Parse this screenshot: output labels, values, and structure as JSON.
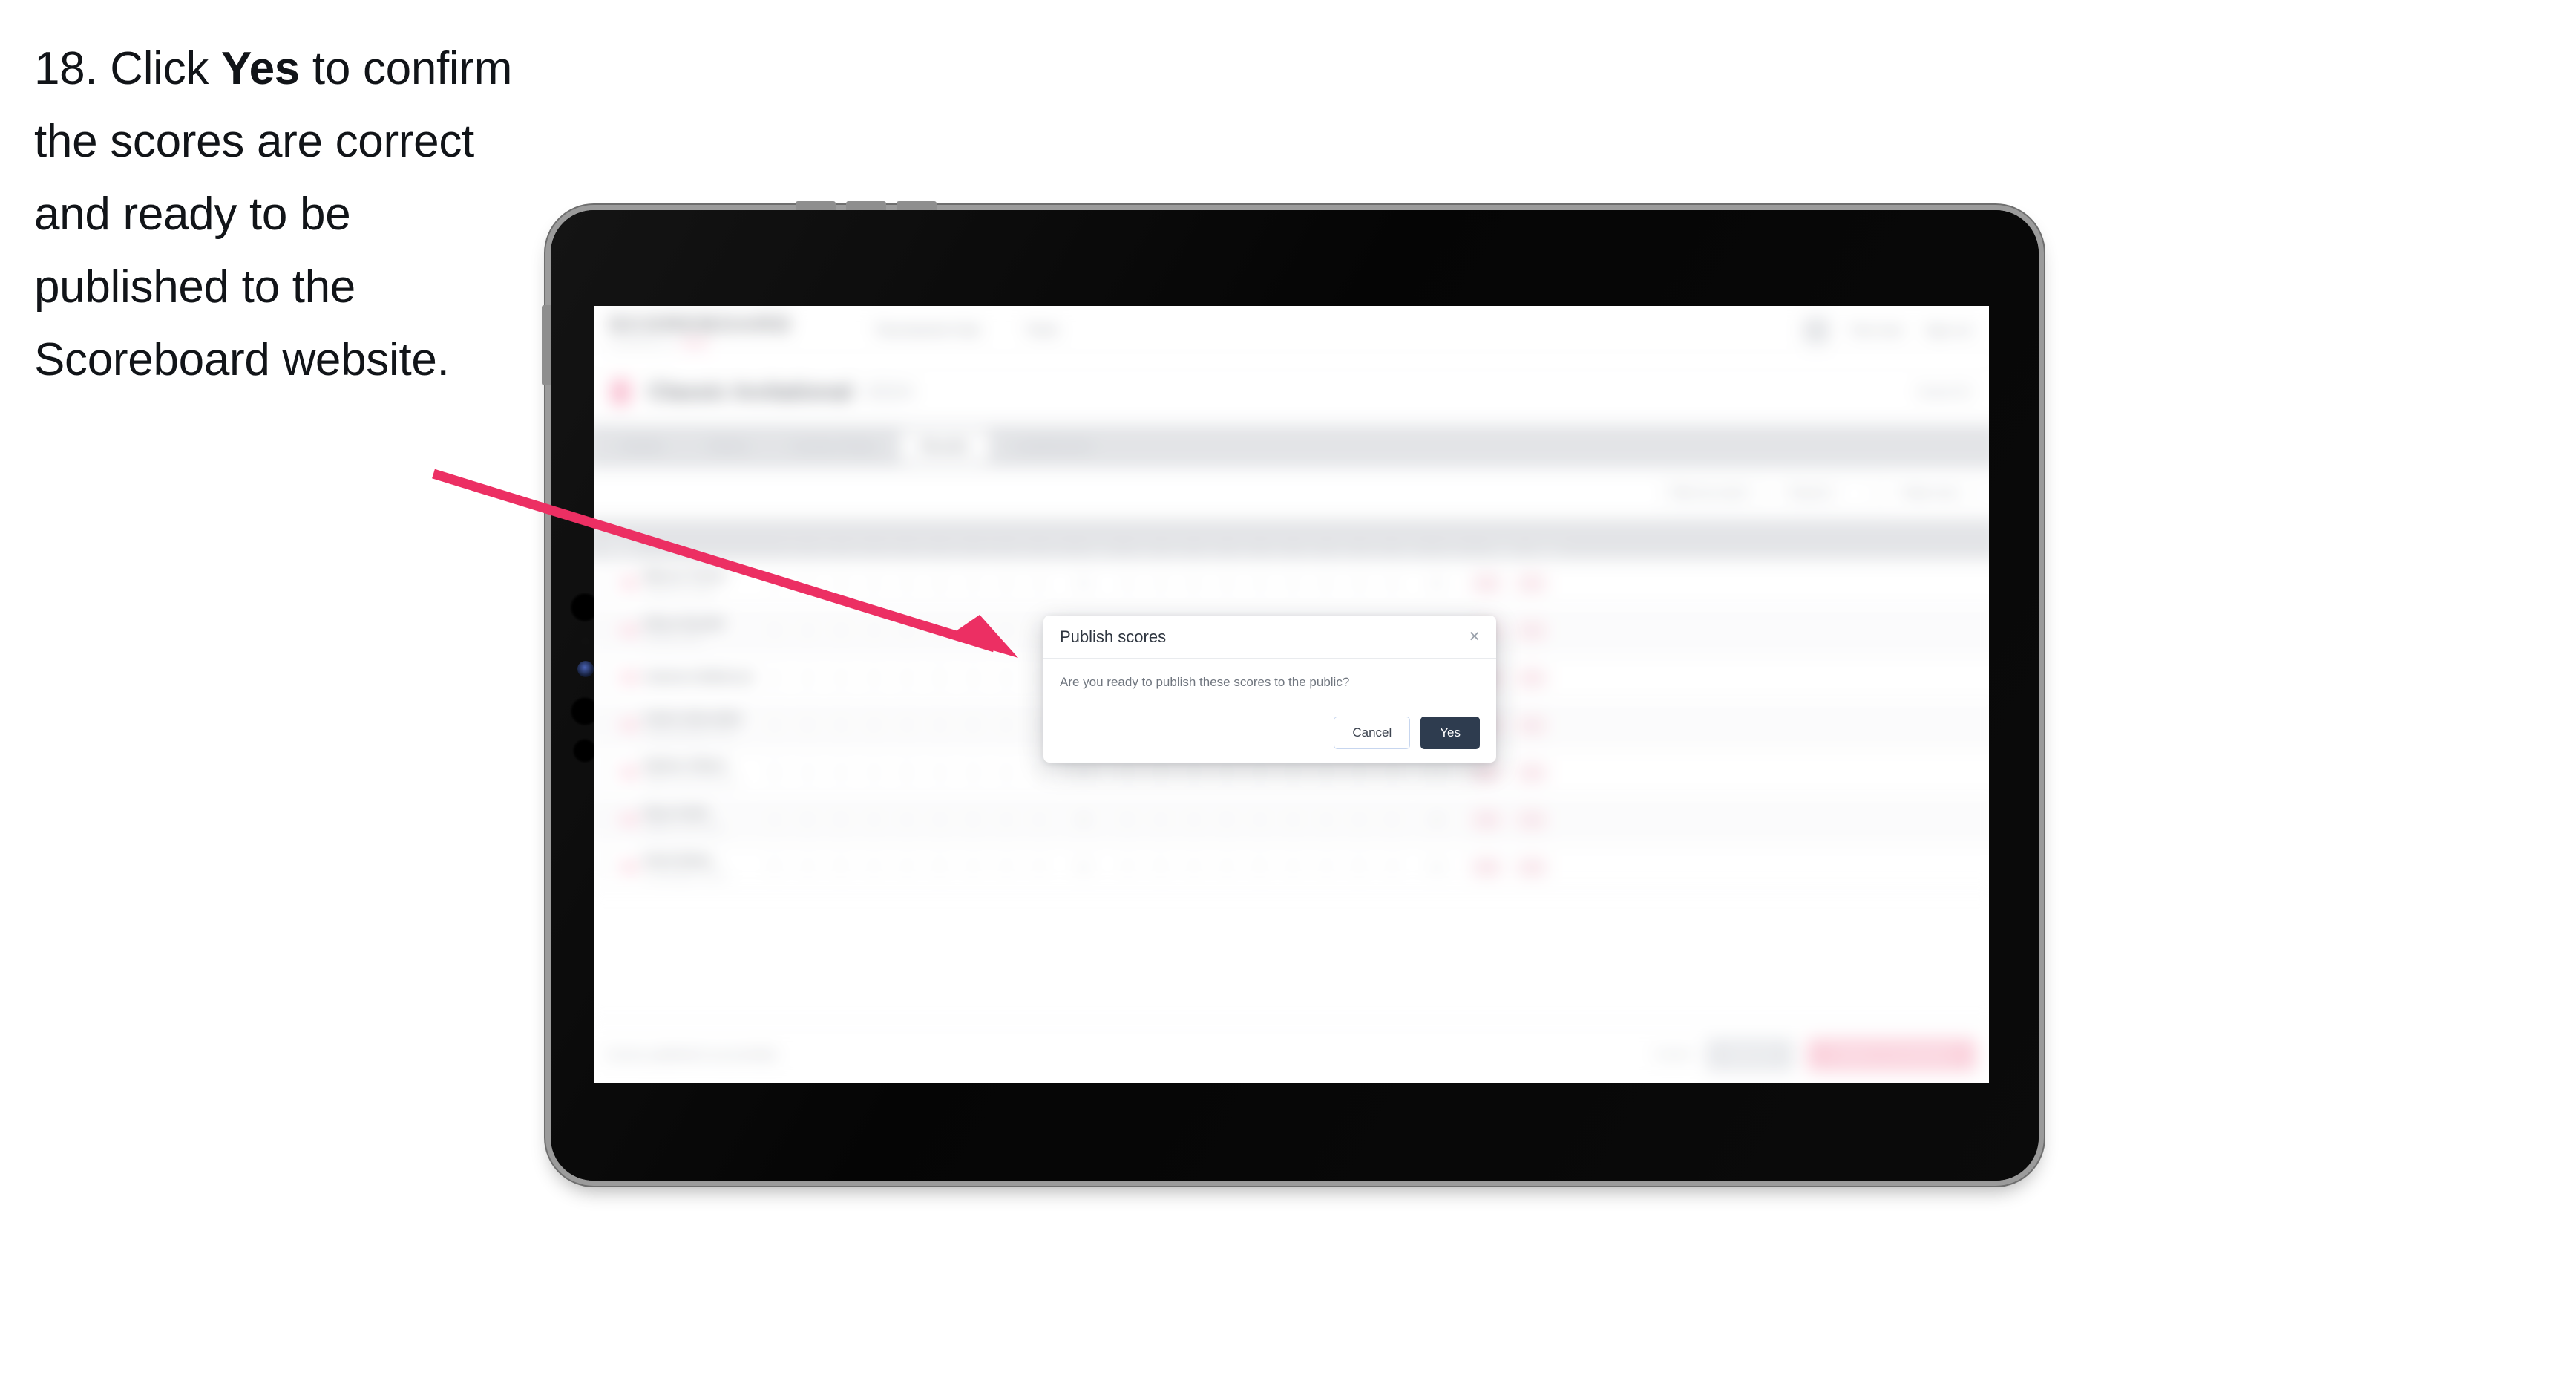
{
  "instruction": {
    "step_number": "18.",
    "text_before": "Click ",
    "bold_word": "Yes",
    "text_after": " to confirm the scores are correct and ready to be published to the Scoreboard website."
  },
  "annotation": {
    "arrow_color": "#ec2f63",
    "points_to": "yes-button"
  },
  "device": {
    "type": "tablet",
    "orientation": "landscape",
    "body_color": "#0a0a0a",
    "bezel_color": "#9b9b9b"
  },
  "app": {
    "header": {
      "brand_name": "SCOREBOARD",
      "brand_sub": "POWERED BY",
      "brand_tag": "GOLF",
      "nav": [
        "Tournament Hub",
        "Tools"
      ],
      "user_name": "Test User",
      "sign_out": "Sign out"
    },
    "title_bar": {
      "event_name": "Classic Invitational",
      "event_year": "2024",
      "right_label": "Event ID"
    },
    "tabs": [
      {
        "label": "Details",
        "active": false
      },
      {
        "label": "Teams",
        "active": false
      },
      {
        "label": "Course Setup",
        "active": false
      },
      {
        "label": "Results",
        "active": true
      },
      {
        "label": "Leaderboard",
        "active": false
      }
    ],
    "filters": {
      "search_placeholder": "Search players",
      "select_round": "Filter by round",
      "select_group": "Round 1",
      "toggle_label": "Totals only"
    },
    "table": {
      "columns": [
        "Player",
        "1",
        "2",
        "3",
        "4",
        "5",
        "6",
        "7",
        "8",
        "9",
        "Out",
        "10",
        "11",
        "12",
        "13",
        "14",
        "15",
        "16",
        "17",
        "18",
        "In",
        "Total",
        "Score"
      ],
      "rows": [
        {
          "name": "Marcus Turner",
          "club": "Oakmont Country",
          "scores": [
            "4",
            "5",
            "3",
            "4",
            "4",
            "5",
            "4",
            "3",
            "4"
          ],
          "out": "36",
          "scores_in": [
            "4",
            "4",
            "5",
            "3",
            "4",
            "4",
            "5",
            "3",
            "4"
          ],
          "in": "36",
          "total": "72",
          "score": "E"
        },
        {
          "name": "Ethan Randall",
          "club": "Pinehurst Golf",
          "scores": [
            "5",
            "4",
            "3",
            "4",
            "5",
            "4",
            "4",
            "3",
            "5"
          ],
          "out": "37",
          "scores_in": [
            "4",
            "5",
            "4",
            "3",
            "4",
            "5",
            "4",
            "4",
            "3"
          ],
          "in": "36",
          "total": "73",
          "score": "+1"
        },
        {
          "name": "Cameron Bellerose",
          "club": "",
          "scores": [
            "4",
            "4",
            "4",
            "4",
            "4",
            "5",
            "3",
            "4",
            "4"
          ],
          "out": "36",
          "scores_in": [
            "5",
            "4",
            "4",
            "4",
            "3",
            "5",
            "4",
            "4",
            "4"
          ],
          "in": "37",
          "total": "73",
          "score": "+1"
        },
        {
          "name": "Calvin Abernathy",
          "club": "Rolling Meadows Club",
          "scores": [
            "4",
            "5",
            "4",
            "3",
            "4",
            "4",
            "5",
            "4",
            "3"
          ],
          "out": "36",
          "scores_in": [
            "4",
            "4",
            "5",
            "4",
            "4",
            "3",
            "5",
            "4",
            "5"
          ],
          "in": "38",
          "total": "74",
          "score": "+2"
        },
        {
          "name": "Nathan Gilbert",
          "club": "Willow Creek Golf Club",
          "scores": [
            "5",
            "4",
            "4",
            "4",
            "5",
            "4",
            "3",
            "4",
            "5"
          ],
          "out": "38",
          "scores_in": [
            "4",
            "5",
            "4",
            "4",
            "4",
            "5",
            "3",
            "4",
            "4"
          ],
          "in": "37",
          "total": "75",
          "score": "+3"
        },
        {
          "name": "Ryan Keller",
          "club": "Bayview Links Club",
          "scores": [
            "4",
            "5",
            "5",
            "4",
            "4",
            "3",
            "5",
            "4",
            "4"
          ],
          "out": "38",
          "scores_in": [
            "5",
            "4",
            "4",
            "5",
            "4",
            "4",
            "4",
            "3",
            "5"
          ],
          "in": "38",
          "total": "76",
          "score": "+4"
        },
        {
          "name": "Noah Bailey",
          "club": "Stonebridge Country",
          "scores": [
            "5",
            "4",
            "5",
            "4",
            "4",
            "5",
            "4",
            "4",
            "4"
          ],
          "out": "39",
          "scores_in": [
            "4",
            "5",
            "4",
            "4",
            "5",
            "4",
            "4",
            "5",
            "4"
          ],
          "in": "39",
          "total": "78",
          "score": "+6"
        }
      ]
    },
    "footer": {
      "note": "Scores published successfully",
      "link_label": "Cancel",
      "secondary_button": "Save all",
      "primary_button": "Publish to Scoreboard"
    }
  },
  "modal": {
    "title": "Publish scores",
    "close_icon": "×",
    "body": "Are you ready to publish these scores to the public?",
    "cancel_label": "Cancel",
    "confirm_label": "Yes",
    "confirm_color": "#2e3c4f"
  }
}
